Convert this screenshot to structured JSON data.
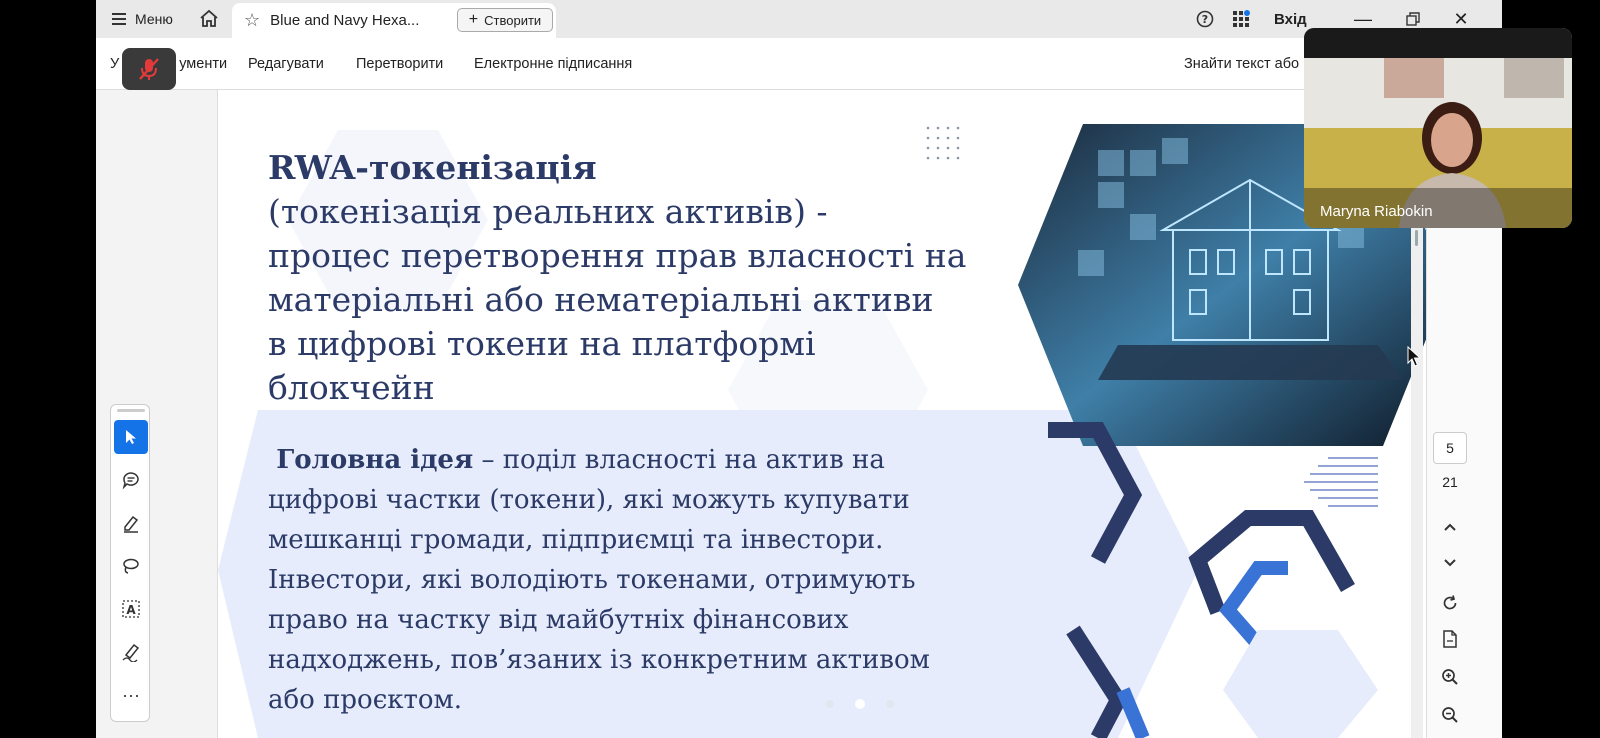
{
  "titlebar": {
    "menu_label": "Меню",
    "tab_title": "Blue and Navy Hexa...",
    "create_label": "Створити",
    "signin_label": "Вхід"
  },
  "toolbar": {
    "tools_label": "Усі інструменти",
    "tools_label_visible": "ументи",
    "edit_label": "Редагувати",
    "convert_label": "Перетворити",
    "esign_label": "Електронне підписання",
    "find_label": "Знайти текст або інструменти"
  },
  "slide": {
    "heading_bold": "RWA-токенізація",
    "heading_lines": [
      "(токенізація реальних  активів) -",
      "процес перетворення прав власності на",
      "матеріальні або нематеріальні активи",
      "в цифрові токени на платформі",
      "блокчейн"
    ],
    "idea_bold": "Головна ідея",
    "idea_first": " – поділ власності на актив на",
    "idea_lines": [
      "цифрові частки (токени), які можуть купувати",
      "мешканці громади, підприємці та інвестори.",
      "Інвестори, які володіють токенами, отримують",
      "право на частку від майбутніх фінансових",
      "надходжень, пов’язаних із конкретним активом",
      "або проєктом."
    ]
  },
  "navigation": {
    "current_page": "5",
    "total_pages": "21"
  },
  "video": {
    "participant_name": "Maryna Riabokin"
  },
  "colors": {
    "navy": "#2b3a67",
    "accent_blue": "#1473e6",
    "hex_light": "#e6ecfb"
  }
}
